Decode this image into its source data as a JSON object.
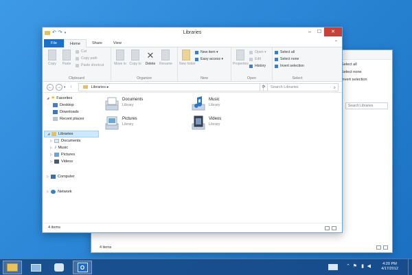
{
  "main_window": {
    "title": "Libraries",
    "tabs": [
      "File",
      "Home",
      "Share",
      "View"
    ],
    "ribbon": {
      "clipboard": {
        "label": "Clipboard",
        "copy": "Copy",
        "paste": "Paste",
        "cut": "Cut",
        "copy_path": "Copy path",
        "paste_shortcut": "Paste shortcut"
      },
      "organize": {
        "label": "Organize",
        "move_to": "Move to",
        "copy_to": "Copy to",
        "delete": "Delete",
        "rename": "Rename"
      },
      "new": {
        "label": "New",
        "new_folder": "New folder",
        "new_item": "New item ▾",
        "easy_access": "Easy access ▾"
      },
      "open": {
        "label": "Open",
        "properties": "Properties",
        "open": "Open ▾",
        "edit": "Edit",
        "history": "History"
      },
      "select": {
        "label": "Select",
        "select_all": "Select all",
        "select_none": "Select none",
        "invert_selection": "Invert selection"
      }
    },
    "address": {
      "path": "Libraries ▸",
      "search_placeholder": "Search Libraries"
    },
    "nav_tree": {
      "favorites": "Favorites",
      "desktop": "Desktop",
      "downloads": "Downloads",
      "recent_places": "Recent places",
      "libraries": "Libraries",
      "documents": "Documents",
      "music": "Music",
      "pictures": "Pictures",
      "videos": "Videos",
      "computer": "Computer",
      "network": "Network"
    },
    "items": [
      {
        "name": "Documents",
        "type": "Library"
      },
      {
        "name": "Music",
        "type": "Library"
      },
      {
        "name": "Pictures",
        "type": "Library"
      },
      {
        "name": "Videos",
        "type": "Library"
      }
    ],
    "status": "4 items"
  },
  "back_window": {
    "ribbon": {
      "select_all": "Select all",
      "select_none": "Select none",
      "invert_selection": "Invert selection"
    },
    "search_placeholder": "Search Libraries",
    "status": "4 items"
  },
  "taskbar": {
    "time": "4:20 PM",
    "date": "4/17/2012"
  },
  "colors": {
    "accent": "#1a6fc6",
    "close": "#c7403a",
    "desktop": "#2f8ad8"
  }
}
